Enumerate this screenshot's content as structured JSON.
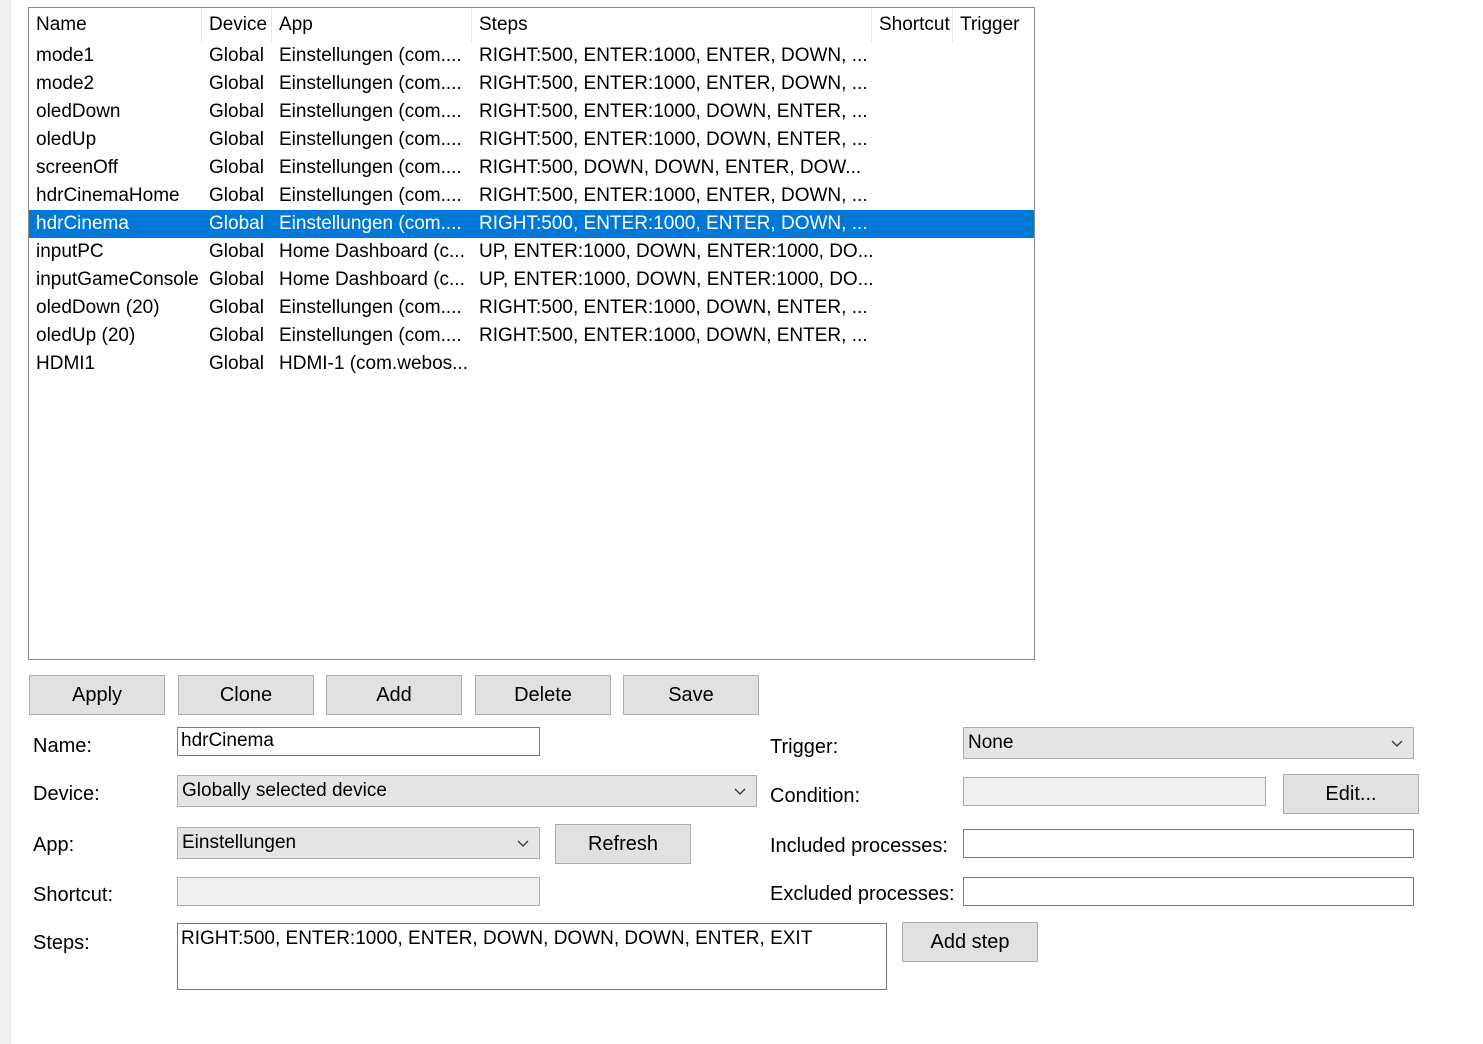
{
  "list": {
    "columns": [
      "Name",
      "Device",
      "App",
      "Steps",
      "Shortcut",
      "Trigger"
    ],
    "rows": [
      {
        "name": "mode1",
        "device": "Global",
        "app": "Einstellungen (com....",
        "steps": "RIGHT:500, ENTER:1000, ENTER, DOWN, ..."
      },
      {
        "name": "mode2",
        "device": "Global",
        "app": "Einstellungen (com....",
        "steps": "RIGHT:500, ENTER:1000, ENTER, DOWN, ..."
      },
      {
        "name": "oledDown",
        "device": "Global",
        "app": "Einstellungen (com....",
        "steps": "RIGHT:500, ENTER:1000, DOWN, ENTER, ..."
      },
      {
        "name": "oledUp",
        "device": "Global",
        "app": "Einstellungen (com....",
        "steps": "RIGHT:500, ENTER:1000, DOWN, ENTER, ..."
      },
      {
        "name": "screenOff",
        "device": "Global",
        "app": "Einstellungen (com....",
        "steps": "RIGHT:500, DOWN, DOWN, ENTER, DOW..."
      },
      {
        "name": "hdrCinemaHome",
        "device": "Global",
        "app": "Einstellungen (com....",
        "steps": "RIGHT:500, ENTER:1000, ENTER, DOWN, ..."
      },
      {
        "name": "hdrCinema",
        "device": "Global",
        "app": "Einstellungen (com....",
        "steps": "RIGHT:500, ENTER:1000, ENTER, DOWN, ...",
        "selected": true
      },
      {
        "name": "inputPC",
        "device": "Global",
        "app": "Home Dashboard (c...",
        "steps": "UP, ENTER:1000, DOWN, ENTER:1000, DO..."
      },
      {
        "name": "inputGameConsole",
        "device": "Global",
        "app": "Home Dashboard (c...",
        "steps": "UP, ENTER:1000, DOWN, ENTER:1000, DO..."
      },
      {
        "name": "oledDown (20)",
        "device": "Global",
        "app": "Einstellungen (com....",
        "steps": "RIGHT:500, ENTER:1000, DOWN, ENTER, ..."
      },
      {
        "name": "oledUp (20)",
        "device": "Global",
        "app": "Einstellungen (com....",
        "steps": "RIGHT:500, ENTER:1000, DOWN, ENTER, ..."
      },
      {
        "name": "HDMI1",
        "device": "Global",
        "app": "HDMI-1 (com.webos...",
        "steps": ""
      }
    ]
  },
  "buttons": {
    "apply": "Apply",
    "clone": "Clone",
    "add": "Add",
    "delete": "Delete",
    "save": "Save",
    "refresh": "Refresh",
    "edit": "Edit...",
    "add_step": "Add step"
  },
  "form": {
    "name_label": "Name:",
    "name_value": "hdrCinema",
    "device_label": "Device:",
    "device_value": "Globally selected device",
    "app_label": "App:",
    "app_value": "Einstellungen",
    "shortcut_label": "Shortcut:",
    "shortcut_value": "",
    "steps_label": "Steps:",
    "steps_value": "RIGHT:500, ENTER:1000, ENTER, DOWN, DOWN, DOWN, ENTER, EXIT",
    "trigger_label": "Trigger:",
    "trigger_value": "None",
    "condition_label": "Condition:",
    "condition_value": "",
    "included_label": "Included processes:",
    "included_value": "",
    "excluded_label": "Excluded processes:",
    "excluded_value": ""
  },
  "icons": {
    "dropdown": "chevron-down-icon"
  },
  "colors": {
    "selection": "#0078d7",
    "button_bg": "#e1e1e1",
    "combo_bg": "#e5e5e5"
  }
}
